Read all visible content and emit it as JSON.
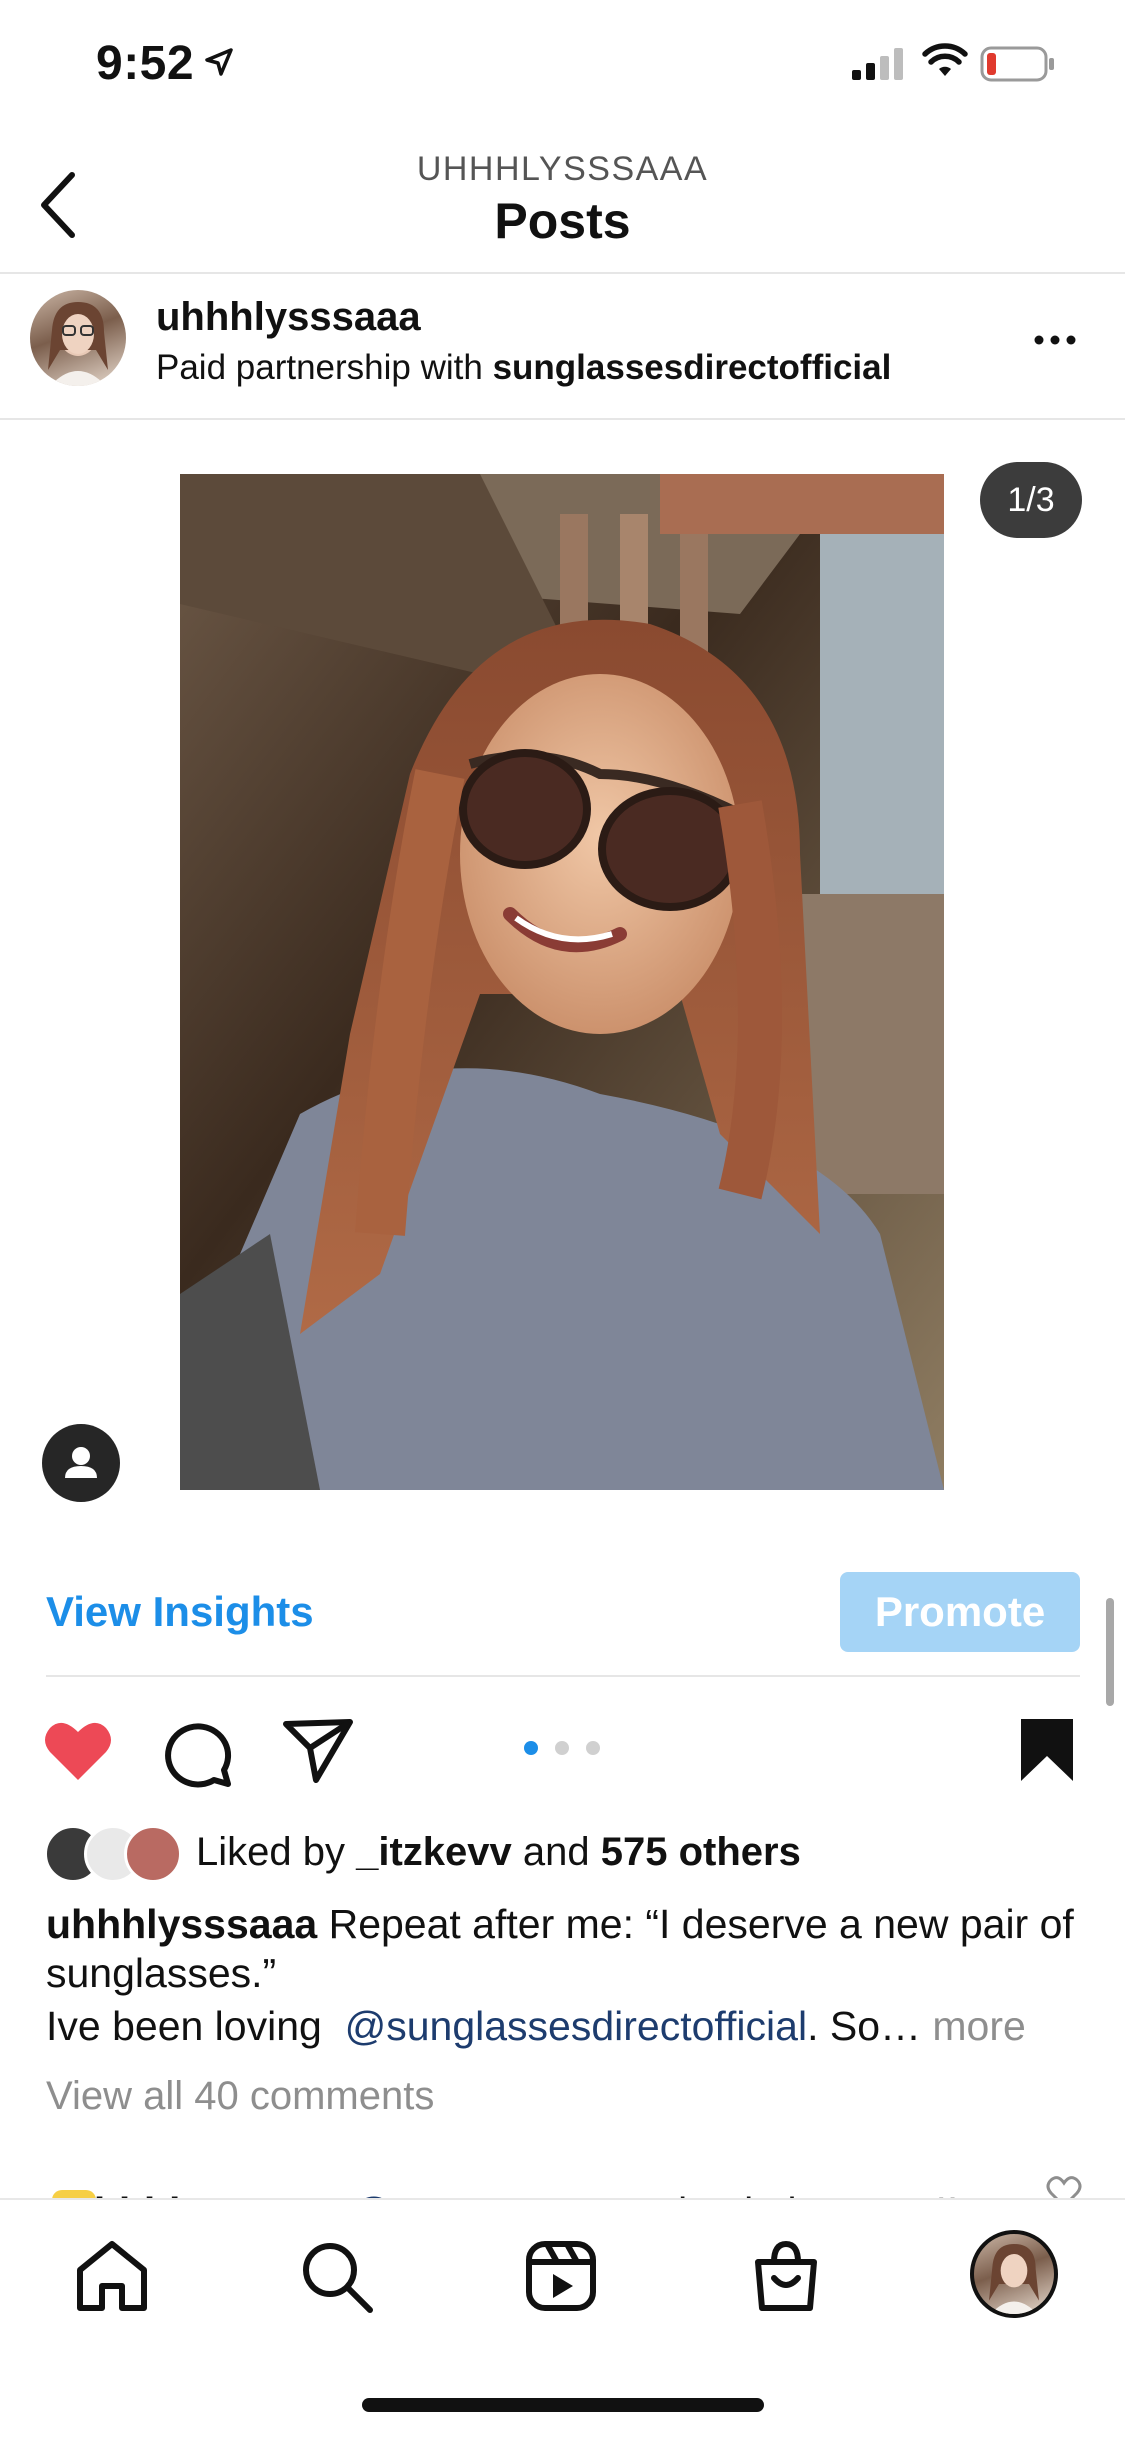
{
  "status_bar": {
    "time": "9:52"
  },
  "header": {
    "account": "UHHHLYSSSAAA",
    "title": "Posts"
  },
  "post": {
    "username": "uhhhlysssaaa",
    "partnership_prefix": "Paid partnership with ",
    "partner": "sunglassesdirectofficial",
    "image_counter": "1/3"
  },
  "insights": {
    "view_label": "View Insights",
    "promote_label": "Promote"
  },
  "likes": {
    "prefix": "Liked by ",
    "user": "_itzkevv",
    "middle": " and ",
    "count": "575 others"
  },
  "caption": {
    "username": "uhhhlysssaaa",
    "line1": " Repeat after me: “I deserve a new pair of sunglasses.”",
    "line2_prefix": "Ive been loving  ",
    "mention": "@sunglassesdirectofficial",
    "line2_suffix": ". So… ",
    "more": "more"
  },
  "comments": {
    "view_all": "View all 40 comments",
    "first_username": "uhhhlysssaaa",
    "first_mention": "@anaperu__",
    "first_text": " go check them out!!"
  },
  "colors": {
    "like_red": "#ed4956",
    "link_blue": "#1c8ee8",
    "promote_bg": "#a5d4f6",
    "mention_navy": "#1d3c6e"
  },
  "carousel": {
    "current": 1,
    "total": 3
  },
  "icons": [
    "location-arrow-icon",
    "signal-icon",
    "wifi-icon",
    "battery-icon",
    "back-chevron-icon",
    "more-icon",
    "person-tag-icon",
    "heart-icon",
    "comment-icon",
    "share-icon",
    "bookmark-icon",
    "home-icon",
    "search-icon",
    "reels-icon",
    "shop-icon",
    "profile-icon"
  ]
}
